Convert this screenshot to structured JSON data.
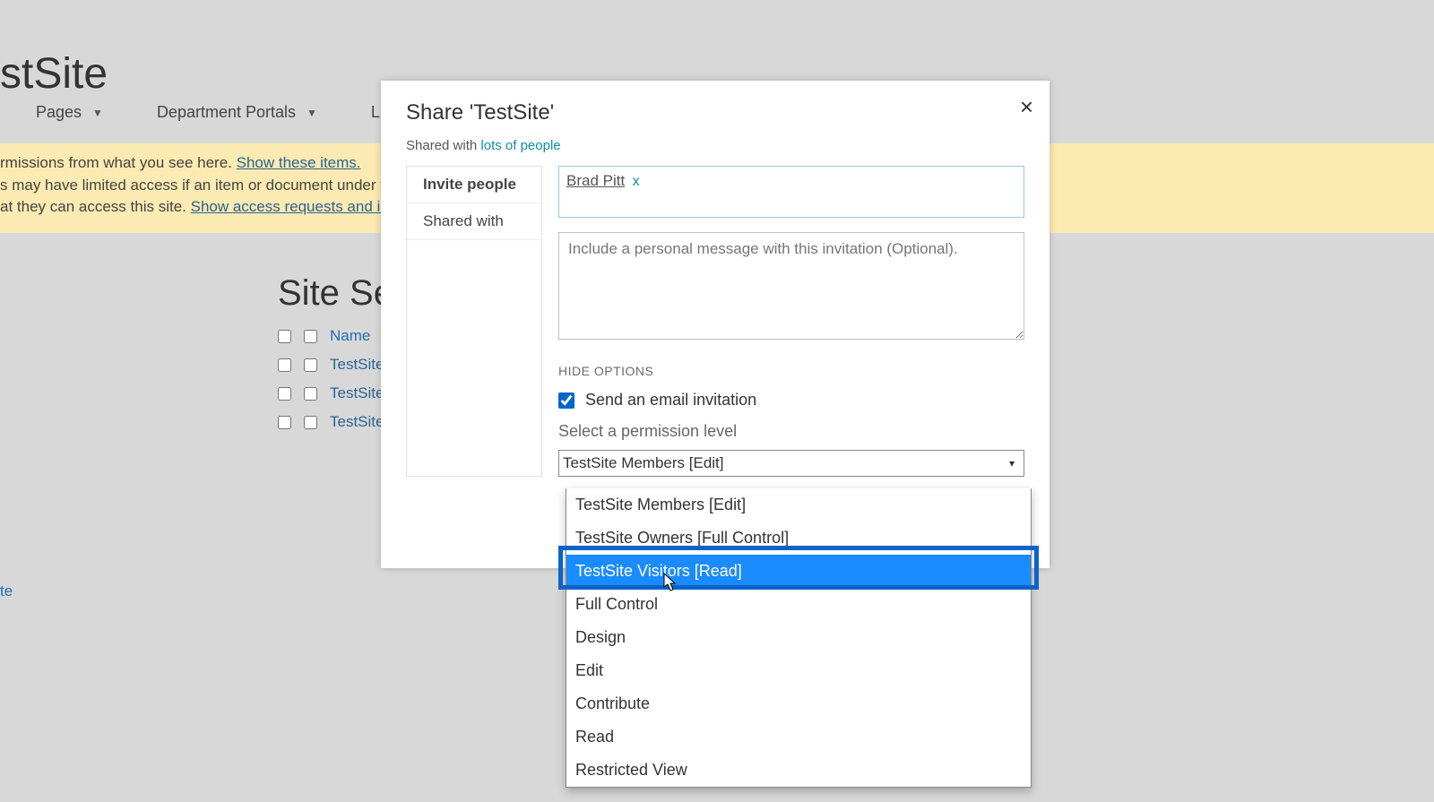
{
  "background": {
    "site_title": "stSite",
    "nav": {
      "pages": "Pages",
      "dept": "Department Portals",
      "lists": "Lists"
    },
    "banner": {
      "line1a": "rmissions from what you see here.  ",
      "line1_link": "Show these items.",
      "line2a": "s may have limited access if an item or document under the site",
      "line3a": "at they can access this site. ",
      "line3_link": "Show access requests and invitation"
    },
    "section_title": "Site Sett",
    "table": {
      "name_header": "Name",
      "rows": [
        "TestSite",
        "TestSite",
        "TestSite"
      ]
    },
    "truncated_bottom": "te"
  },
  "dialog": {
    "title": "Share 'TestSite'",
    "shared_prefix": "Shared with ",
    "shared_link": "lots of people",
    "tabs": {
      "invite": "Invite people",
      "shared": "Shared with"
    },
    "person_chip": "Brad Pitt",
    "chip_x": "x",
    "message_placeholder": "Include a personal message with this invitation (Optional).",
    "hide_options": "HIDE OPTIONS",
    "send_email": "Send an email invitation",
    "perm_label": "Select a permission level",
    "perm_selected": "TestSite Members [Edit]",
    "perm_options": [
      "TestSite Members [Edit]",
      "TestSite Owners [Full Control]",
      "TestSite Visitors [Read]",
      "Full Control",
      "Design",
      "Edit",
      "Contribute",
      "Read",
      "Restricted View"
    ],
    "highlighted_index": 2
  }
}
